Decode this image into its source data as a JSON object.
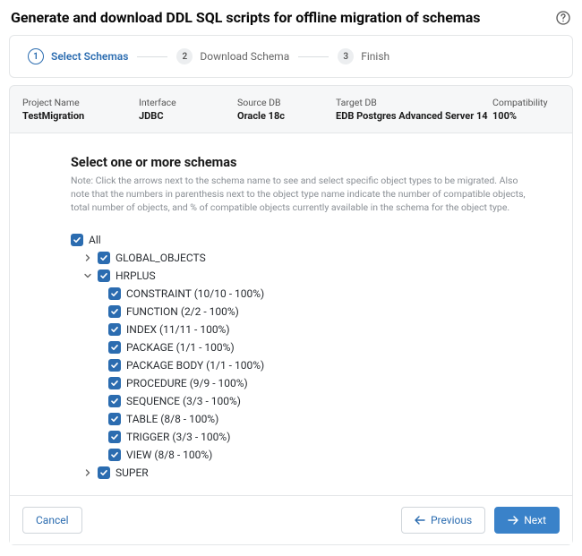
{
  "header": {
    "title": "Generate and download DDL SQL scripts for offline migration of schemas"
  },
  "stepper": {
    "steps": [
      {
        "num": "1",
        "label": "Select Schemas",
        "active": true
      },
      {
        "num": "2",
        "label": "Download Schema",
        "active": false
      },
      {
        "num": "3",
        "label": "Finish",
        "active": false
      }
    ]
  },
  "info": {
    "project_label": "Project Name",
    "project_value": "TestMigration",
    "interface_label": "Interface",
    "interface_value": "JDBC",
    "source_label": "Source DB",
    "source_value": "Oracle 18c",
    "target_label": "Target DB",
    "target_value": "EDB Postgres Advanced Server 14",
    "compat_label": "Compatibility",
    "compat_value": "100%"
  },
  "section": {
    "title": "Select one or more schemas",
    "note": "Note: Click the arrows next to the schema name to see and select specific object types to be migrated. Also note that the numbers in parenthesis next to the object type name indicate the number of compatible objects, total number of objects, and % of compatible objects currently available in the schema for the object type."
  },
  "tree": {
    "all": "All",
    "global": "GLOBAL_OBJECTS",
    "hrplus": "HRPLUS",
    "items": [
      "CONSTRAINT (10/10 - 100%)",
      "FUNCTION (2/2 - 100%)",
      "INDEX (11/11 - 100%)",
      "PACKAGE (1/1 - 100%)",
      "PACKAGE BODY (1/1 - 100%)",
      "PROCEDURE (9/9 - 100%)",
      "SEQUENCE (3/3 - 100%)",
      "TABLE (8/8 - 100%)",
      "TRIGGER (3/3 - 100%)",
      "VIEW (8/8 - 100%)"
    ],
    "super": "SUPER"
  },
  "footer": {
    "cancel": "Cancel",
    "previous": "Previous",
    "next": "Next"
  }
}
